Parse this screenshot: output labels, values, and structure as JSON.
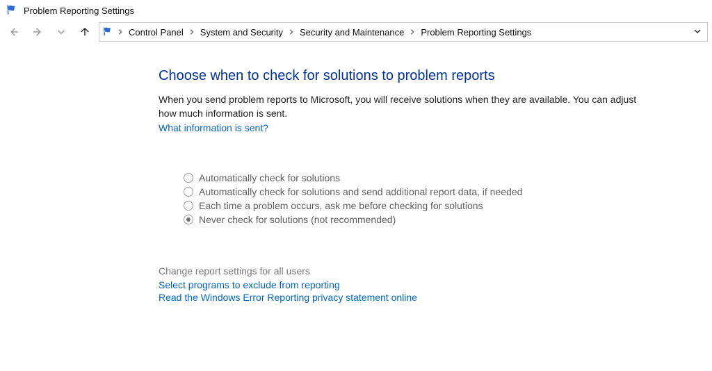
{
  "window": {
    "title": "Problem Reporting Settings"
  },
  "breadcrumb": {
    "items": [
      {
        "label": "Control Panel"
      },
      {
        "label": "System and Security"
      },
      {
        "label": "Security and Maintenance"
      },
      {
        "label": "Problem Reporting Settings"
      }
    ]
  },
  "main": {
    "heading": "Choose when to check for solutions to problem reports",
    "description": "When you send problem reports to Microsoft, you will receive solutions when they are available. You can adjust how much information is sent.",
    "info_link": "What information is sent?"
  },
  "options": [
    {
      "label": "Automatically check for solutions",
      "selected": false
    },
    {
      "label": "Automatically check for solutions and send additional report data, if needed",
      "selected": false
    },
    {
      "label": "Each time a problem occurs, ask me before checking for solutions",
      "selected": false
    },
    {
      "label": "Never check for solutions (not recommended)",
      "selected": true
    }
  ],
  "footer": {
    "all_users": "Change report settings for all users",
    "exclude": "Select programs to exclude from reporting",
    "privacy": "Read the Windows Error Reporting privacy statement online"
  }
}
